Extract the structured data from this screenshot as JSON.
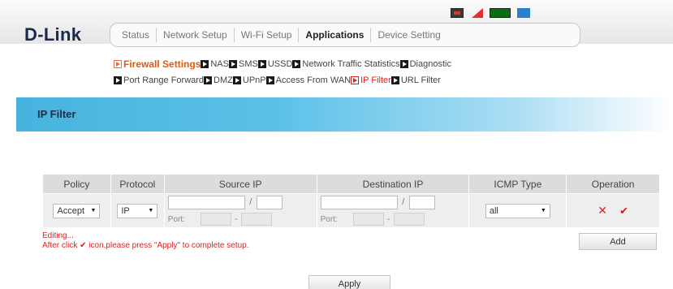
{
  "brand": {
    "logo": "D-Link"
  },
  "status_icons": [
    "sim-card-icon",
    "no-signal-icon",
    "battery-icon",
    "user-icon"
  ],
  "nav": {
    "items": [
      {
        "label": "Status"
      },
      {
        "label": "Network Setup"
      },
      {
        "label": "Wi-Fi Setup"
      },
      {
        "label": "Applications",
        "active": true
      },
      {
        "label": "Device Setting"
      }
    ]
  },
  "submenu": {
    "row1": [
      "Firewall Settings",
      "NAS",
      "SMS",
      "USSD",
      "Network Traffic Statistics",
      "Diagnostic"
    ],
    "row2": [
      "Port Range Forward",
      "DMZ",
      "UPnP",
      "Access From WAN",
      "IP Filter",
      "URL Filter"
    ]
  },
  "page": {
    "title": "IP Filter"
  },
  "table": {
    "headers": {
      "policy": "Policy",
      "protocol": "Protocol",
      "source": "Source IP",
      "destination": "Destination IP",
      "icmp": "ICMP Type",
      "operation": "Operation"
    },
    "row": {
      "policy": "Accept",
      "protocol": "IP",
      "slash": "/",
      "port_label": "Port:",
      "dash": "-",
      "icmp": "all",
      "delete_glyph": "✕",
      "confirm_glyph": "✔"
    }
  },
  "notes": {
    "line1": "Editing...",
    "line2_pre": "After click ",
    "line2_glyph": "✔",
    "line2_post": " icon,please press \"Apply\" to complete setup."
  },
  "buttons": {
    "add": "Add",
    "apply": "Apply"
  },
  "colors": {
    "accent": "#e05a10",
    "alert": "#e02020",
    "band": "#46b3de"
  }
}
